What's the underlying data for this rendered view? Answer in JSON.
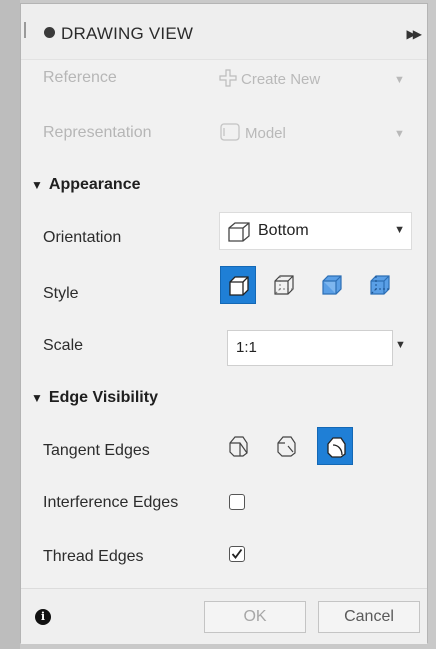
{
  "panel": {
    "title": "DRAWING VIEW",
    "collapse_icon": "double-chevron-right-icon"
  },
  "reference": {
    "label": "Reference",
    "value": "Create New",
    "icon": "create-new-icon",
    "enabled": false
  },
  "representation": {
    "label": "Representation",
    "value": "Model",
    "icon": "model-icon",
    "enabled": false
  },
  "appearance": {
    "header": "Appearance",
    "orientation": {
      "label": "Orientation",
      "value": "Bottom",
      "icon": "cube-orientation-icon"
    },
    "style": {
      "label": "Style",
      "options": [
        "visible-edges-icon",
        "visible-and-hidden-edges-icon",
        "shaded-icon",
        "shaded-with-hidden-edges-icon"
      ],
      "selected_index": 0
    },
    "scale": {
      "label": "Scale",
      "value": "1:1"
    }
  },
  "edge_visibility": {
    "header": "Edge Visibility",
    "tangent_edges": {
      "label": "Tangent Edges",
      "options": [
        "tangent-full-length-icon",
        "tangent-shortened-icon",
        "tangent-off-icon"
      ],
      "selected_index": 2
    },
    "interference_edges": {
      "label": "Interference Edges",
      "checked": false
    },
    "thread_edges": {
      "label": "Thread Edges",
      "checked": true
    }
  },
  "footer": {
    "info_icon": "info-icon",
    "ok_label": "OK",
    "cancel_label": "Cancel"
  },
  "colors": {
    "accent": "#1f7fd6",
    "panel_bg": "#f1f1f1"
  }
}
